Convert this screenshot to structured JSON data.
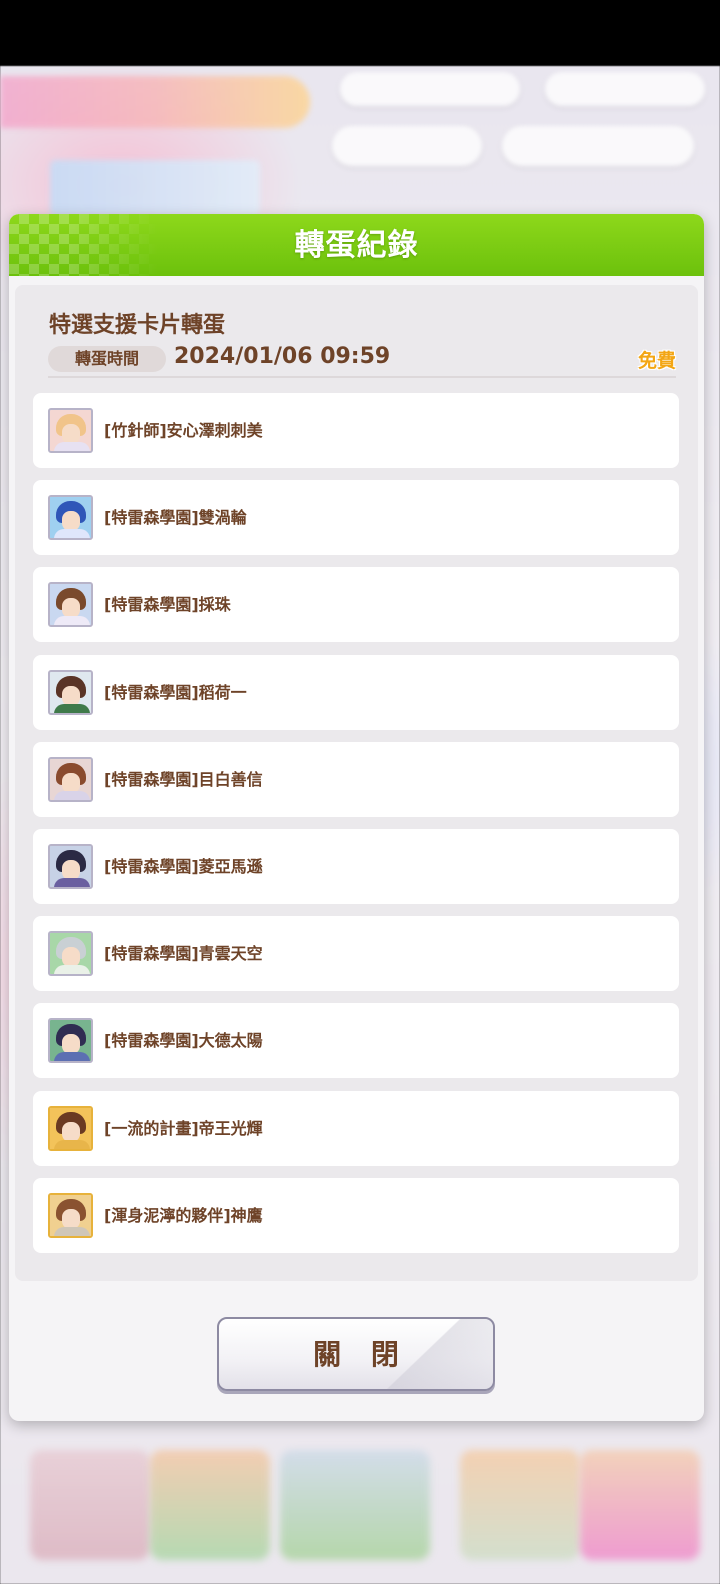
{
  "dialog": {
    "title": "轉蛋紀錄",
    "gacha_name": "特選支援卡片轉蛋",
    "time_label": "轉蛋時間",
    "time_value": "2024/01/06 09:59",
    "cost_badge": "免費",
    "close_label": "關 閉"
  },
  "cards": [
    {
      "name": "[竹針師]安心澤刺刺美",
      "frame": "silver",
      "hair": "#f1c48a",
      "body": "#e7e1f2",
      "bg": "#f4d7d2"
    },
    {
      "name": "[特雷森學園]雙渦輪",
      "frame": "silver",
      "hair": "#2f56b8",
      "body": "#dfe6fb",
      "bg": "#9fd0f0"
    },
    {
      "name": "[特雷森學園]採珠",
      "frame": "silver",
      "hair": "#7a4a2c",
      "body": "#eeeaf7",
      "bg": "#c9d8f0"
    },
    {
      "name": "[特雷森學園]稻荷一",
      "frame": "silver",
      "hair": "#5a3426",
      "body": "#3f7a4a",
      "bg": "#dfe8ef"
    },
    {
      "name": "[特雷森學園]目白善信",
      "frame": "silver",
      "hair": "#8a4b2e",
      "body": "#d9d3e8",
      "bg": "#e8d6d4"
    },
    {
      "name": "[特雷森學園]菱亞馬遜",
      "frame": "silver",
      "hair": "#2b2a44",
      "body": "#6a5fa0",
      "bg": "#c7d2e6"
    },
    {
      "name": "[特雷森學園]青雲天空",
      "frame": "silver",
      "hair": "#c9d0d4",
      "body": "#eaf1e8",
      "bg": "#a8d7a8"
    },
    {
      "name": "[特雷森學園]大德太陽",
      "frame": "silver",
      "hair": "#302d52",
      "body": "#5c6fb2",
      "bg": "#78b48f"
    },
    {
      "name": "[一流的計畫]帝王光輝",
      "frame": "gold",
      "hair": "#6a3a22",
      "body": "#e8b54a",
      "bg": "#f3c35a"
    },
    {
      "name": "[渾身泥濘的夥伴]神鷹",
      "frame": "gold",
      "hair": "#8a5230",
      "body": "#cfc6b8",
      "bg": "#f0d090"
    }
  ]
}
